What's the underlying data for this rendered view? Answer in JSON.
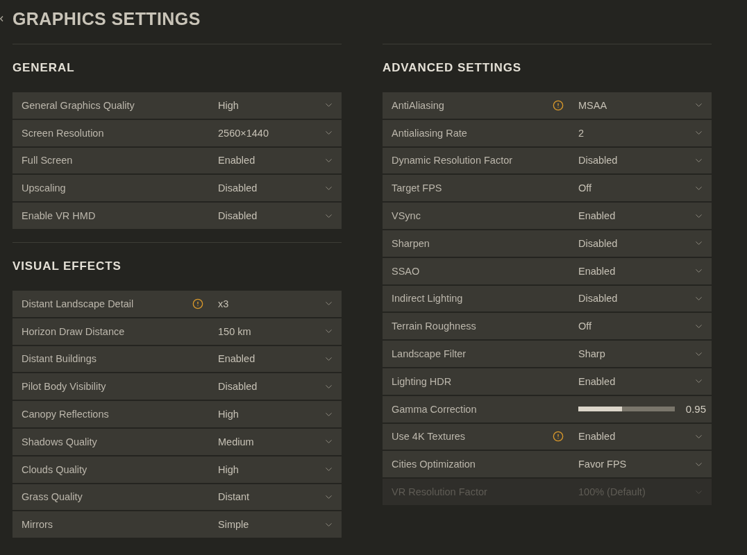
{
  "header": {
    "title": "GRAPHICS SETTINGS"
  },
  "columns": [
    {
      "sections": [
        {
          "title": "GENERAL",
          "settings": [
            {
              "kind": "dropdown",
              "label": "General Graphics Quality",
              "value": "High",
              "warning": false,
              "disabled": false
            },
            {
              "kind": "dropdown",
              "label": "Screen Resolution",
              "value": "2560×1440",
              "warning": false,
              "disabled": false
            },
            {
              "kind": "dropdown",
              "label": "Full Screen",
              "value": "Enabled",
              "warning": false,
              "disabled": false
            },
            {
              "kind": "dropdown",
              "label": "Upscaling",
              "value": "Disabled",
              "warning": false,
              "disabled": false
            },
            {
              "kind": "dropdown",
              "label": "Enable VR HMD",
              "value": "Disabled",
              "warning": false,
              "disabled": false
            }
          ]
        },
        {
          "title": "VISUAL EFFECTS",
          "settings": [
            {
              "kind": "dropdown",
              "label": "Distant Landscape Detail",
              "value": "x3",
              "warning": true,
              "disabled": false
            },
            {
              "kind": "dropdown",
              "label": "Horizon Draw Distance",
              "value": "150 km",
              "warning": false,
              "disabled": false
            },
            {
              "kind": "dropdown",
              "label": "Distant Buildings",
              "value": "Enabled",
              "warning": false,
              "disabled": false
            },
            {
              "kind": "dropdown",
              "label": "Pilot Body Visibility",
              "value": "Disabled",
              "warning": false,
              "disabled": false
            },
            {
              "kind": "dropdown",
              "label": "Canopy Reflections",
              "value": "High",
              "warning": false,
              "disabled": false
            },
            {
              "kind": "dropdown",
              "label": "Shadows Quality",
              "value": "Medium",
              "warning": false,
              "disabled": false
            },
            {
              "kind": "dropdown",
              "label": "Clouds Quality",
              "value": "High",
              "warning": false,
              "disabled": false
            },
            {
              "kind": "dropdown",
              "label": "Grass Quality",
              "value": "Distant",
              "warning": false,
              "disabled": false
            },
            {
              "kind": "dropdown",
              "label": "Mirrors",
              "value": "Simple",
              "warning": false,
              "disabled": false
            }
          ]
        }
      ]
    },
    {
      "sections": [
        {
          "title": "ADVANCED SETTINGS",
          "settings": [
            {
              "kind": "dropdown",
              "label": "AntiAliasing",
              "value": "MSAA",
              "warning": true,
              "disabled": false
            },
            {
              "kind": "dropdown",
              "label": "Antialiasing Rate",
              "value": "2",
              "warning": false,
              "disabled": false
            },
            {
              "kind": "dropdown",
              "label": "Dynamic Resolution Factor",
              "value": "Disabled",
              "warning": false,
              "disabled": false
            },
            {
              "kind": "dropdown",
              "label": "Target FPS",
              "value": "Off",
              "warning": false,
              "disabled": false
            },
            {
              "kind": "dropdown",
              "label": "VSync",
              "value": "Enabled",
              "warning": false,
              "disabled": false
            },
            {
              "kind": "dropdown",
              "label": "Sharpen",
              "value": "Disabled",
              "warning": false,
              "disabled": false
            },
            {
              "kind": "dropdown",
              "label": "SSAO",
              "value": "Enabled",
              "warning": false,
              "disabled": false
            },
            {
              "kind": "dropdown",
              "label": "Indirect Lighting",
              "value": "Disabled",
              "warning": false,
              "disabled": false
            },
            {
              "kind": "dropdown",
              "label": "Terrain Roughness",
              "value": "Off",
              "warning": false,
              "disabled": false
            },
            {
              "kind": "dropdown",
              "label": "Landscape Filter",
              "value": "Sharp",
              "warning": false,
              "disabled": false
            },
            {
              "kind": "dropdown",
              "label": "Lighting HDR",
              "value": "Enabled",
              "warning": false,
              "disabled": false
            },
            {
              "kind": "slider",
              "label": "Gamma Correction",
              "level": 0.45,
              "reading": "0.95",
              "warning": false,
              "disabled": false
            },
            {
              "kind": "dropdown",
              "label": "Use 4K Textures",
              "value": "Enabled",
              "warning": true,
              "disabled": false
            },
            {
              "kind": "dropdown",
              "label": "Cities Optimization",
              "value": "Favor FPS",
              "warning": false,
              "disabled": false
            },
            {
              "kind": "dropdown",
              "label": "VR Resolution Factor",
              "value": "100% (Default)",
              "warning": false,
              "disabled": true
            }
          ]
        }
      ]
    }
  ]
}
